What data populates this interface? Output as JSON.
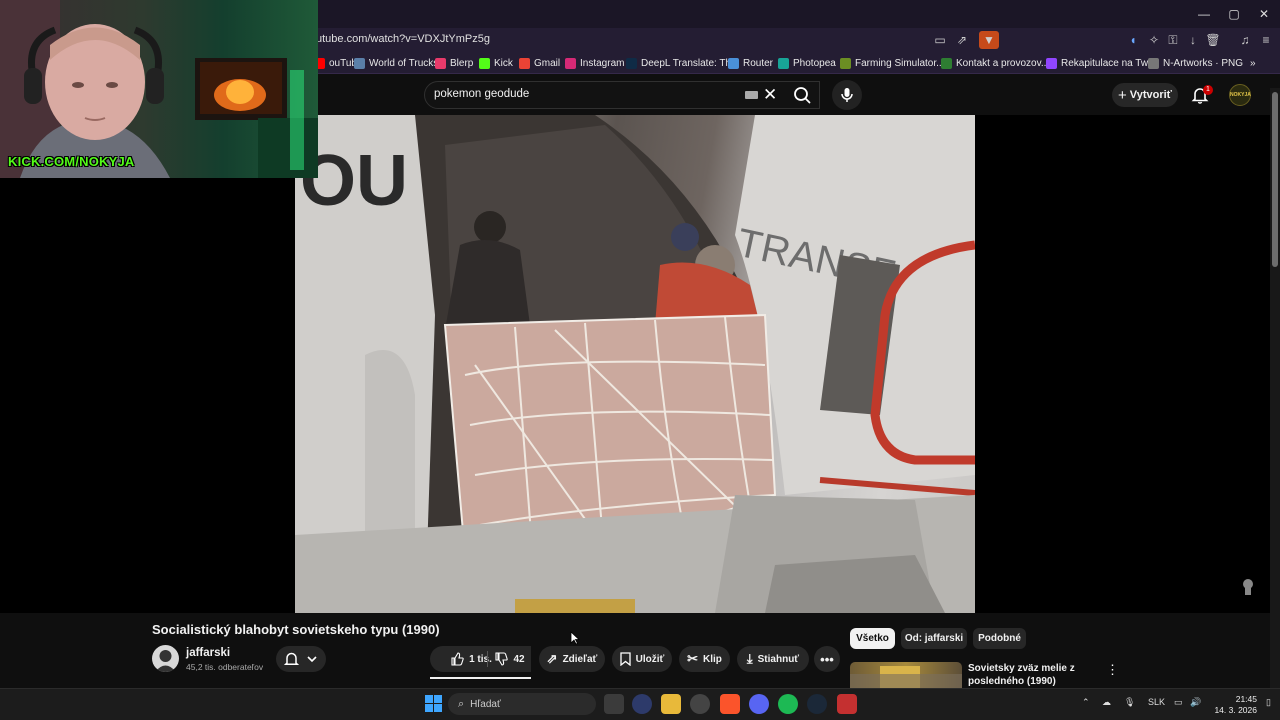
{
  "browser": {
    "url": "utube.com/watch?v=VDXJtYmPz5g",
    "window_controls": [
      "—",
      "▢",
      "✕"
    ],
    "bookmarks": [
      {
        "label": "ouTube",
        "color": "#ff0000"
      },
      {
        "label": "World of Trucks",
        "color": "#5a7fa8"
      },
      {
        "label": "Blerp",
        "color": "#e83a6b"
      },
      {
        "label": "Kick",
        "color": "#53fc18"
      },
      {
        "label": "Gmail",
        "color": "#ea4335"
      },
      {
        "label": "Instagram",
        "color": "#d62976"
      },
      {
        "label": "DeepL Translate: Th...",
        "color": "#0f2b46"
      },
      {
        "label": "Router",
        "color": "#4a90d9"
      },
      {
        "label": "Photopea",
        "color": "#18a497"
      },
      {
        "label": "Farming Simulator...",
        "color": "#6b8e23"
      },
      {
        "label": "Kontakt a provozov...",
        "color": "#2e7d32"
      },
      {
        "label": "Rekapitulace na Twi...",
        "color": "#9146ff"
      },
      {
        "label": "N-Artworks · PNG",
        "color": "#777777"
      }
    ]
  },
  "youtube": {
    "search_query": "pokemon geodude",
    "create_label": "Vytvoriť",
    "notification_count": "1",
    "avatar_text": "NOKYJA"
  },
  "webcam": {
    "overlay_text": "KICK.COM/NOKYJA"
  },
  "video": {
    "title": "Socialistický blahobyt sovietskeho typu (1990)",
    "channel": "jaffarski",
    "subscribers": "45,2 tis. odberateľov",
    "actions": {
      "like_count": "1 tis.",
      "dislike_count": "42",
      "share": "Zdieľať",
      "save": "Uložiť",
      "clip": "Klip",
      "download": "Stiahnuť"
    }
  },
  "sidebar": {
    "chips": [
      "Všetko",
      "Od: jaffarski",
      "Podobné"
    ],
    "recommendation_title": "Sovietsky zväz melie z posledného (1990)"
  },
  "taskbar": {
    "search_placeholder": "Hľadať",
    "language": "SLK",
    "time": "21:45",
    "date": "14. 3. 2026"
  }
}
